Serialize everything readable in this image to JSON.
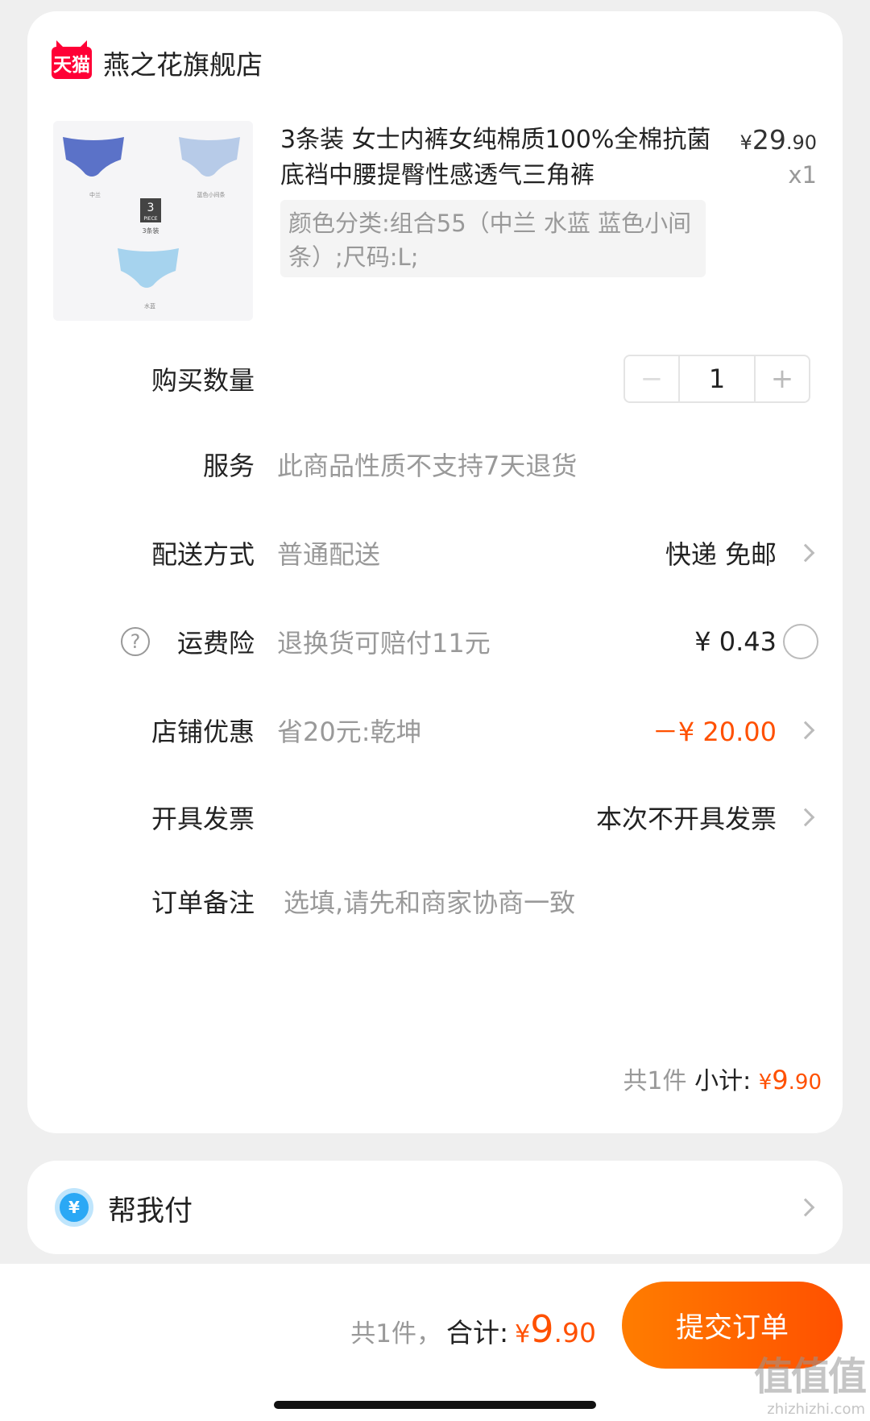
{
  "shop": {
    "logo_text": "天猫",
    "name": "燕之花旗舰店"
  },
  "product": {
    "title": "3条装 女士内裤女纯棉质100%全棉抗菌底裆中腰提臀性感透气三角裤",
    "price_yen": "¥",
    "price_int": "29",
    "price_dec": ".90",
    "quantity_text": "x1",
    "sku": "颜色分类:组合55（中兰 水蓝 蓝色小间条）;尺码:L;",
    "image_labels": {
      "piece_count": "3",
      "piece_text": "PIECE",
      "pack_text": "3条装",
      "color1": "中兰",
      "color2": "蓝色小间条",
      "color3": "水蓝"
    },
    "colors": {
      "item1": "#5b72c8",
      "item2": "#b7cbe8",
      "item3": "#a6d3ee"
    }
  },
  "quantity": {
    "label": "购买数量",
    "minus": "−",
    "value": "1",
    "plus": "+"
  },
  "service": {
    "label": "服务",
    "value": "此商品性质不支持7天退货"
  },
  "delivery": {
    "label": "配送方式",
    "value": "普通配送",
    "right": "快递 免邮"
  },
  "insurance": {
    "icon": "?",
    "label": "运费险",
    "value": "退换货可赔付11元",
    "price": "¥ 0.43"
  },
  "discount": {
    "label": "店铺优惠",
    "value": "省20元:乾坤",
    "amount": "－¥ 20.00"
  },
  "invoice": {
    "label": "开具发票",
    "right": "本次不开具发票"
  },
  "note": {
    "label": "订单备注",
    "placeholder": "选填,请先和商家协商一致"
  },
  "subtotal": {
    "count": "共1件",
    "label": "小计:",
    "yen": "¥",
    "int": "9",
    "dec": ".90"
  },
  "pay_for_me": {
    "icon": "¥",
    "label": "帮我付"
  },
  "footer": {
    "count": "共1件，",
    "label": "合计:",
    "yen": "¥",
    "int": "9",
    "dec": ".90",
    "submit": "提交订单"
  },
  "watermark": {
    "text": "值值值",
    "url": "zhizhizhi.com"
  },
  "colors": {
    "accent": "#ff5000",
    "tmall_red": "#ff0036",
    "pay_blue": "#2aa8f5"
  }
}
